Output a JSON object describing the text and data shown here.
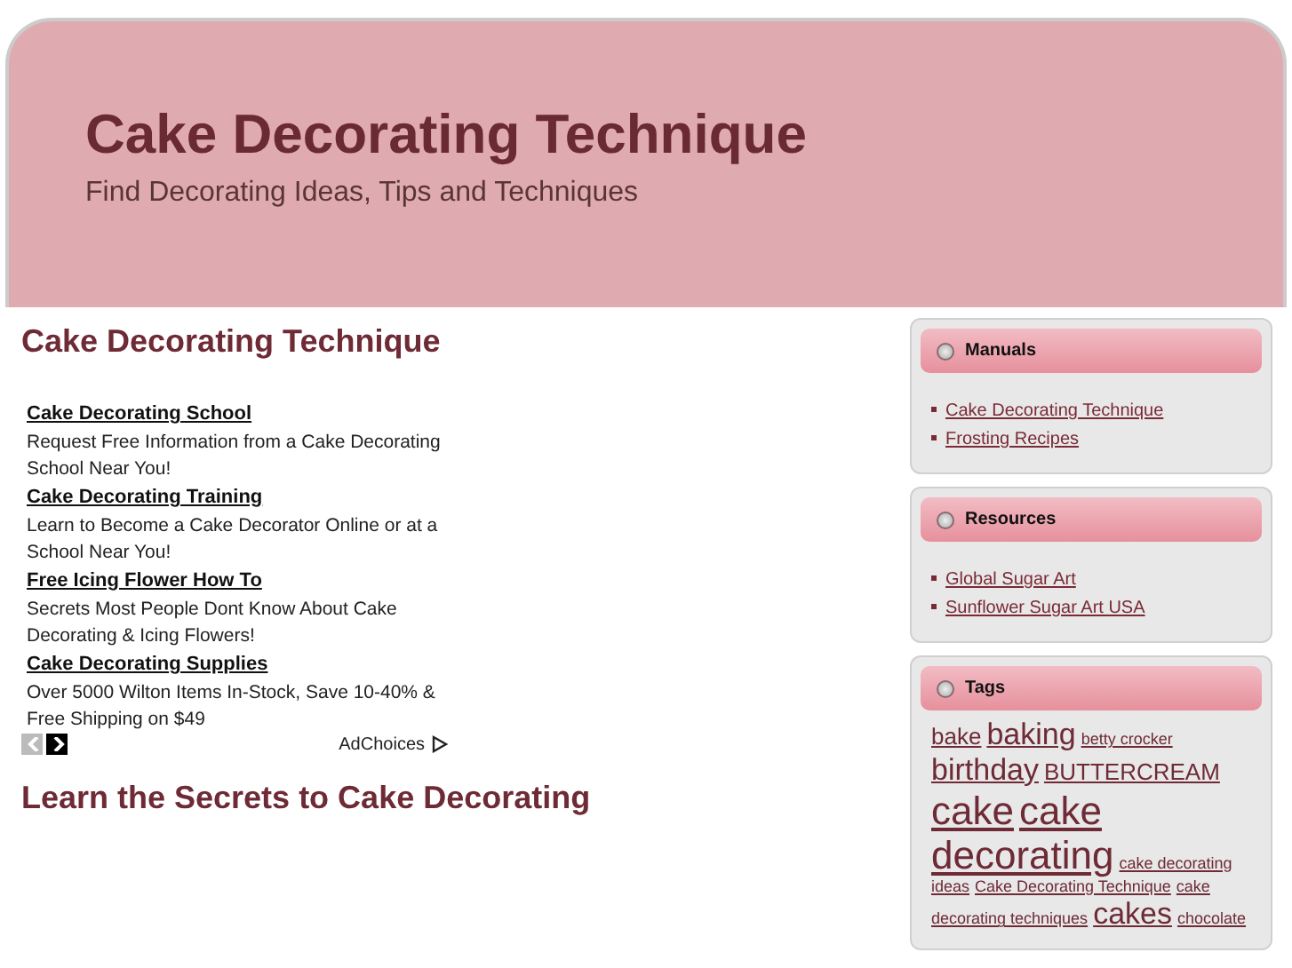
{
  "header": {
    "title": "Cake Decorating Technique",
    "tagline": "Find Decorating Ideas, Tips and Techniques"
  },
  "main": {
    "title": "Cake Decorating Technique",
    "ads": [
      {
        "title": "Cake Decorating School",
        "text": "Request Free Information from a Cake Decorating School Near You!"
      },
      {
        "title": "Cake Decorating Training",
        "text": "Learn to Become a Cake Decorator Online or at a School Near You!"
      },
      {
        "title": "Free Icing Flower How To",
        "text": "Secrets Most People Dont Know About Cake Decorating & Icing Flowers!"
      },
      {
        "title": "Cake Decorating Supplies",
        "text": "Over 5000 Wilton Items In-Stock, Save 10-40% & Free Shipping on $49"
      }
    ],
    "ad_nav": {
      "prev_disabled": true,
      "next_disabled": false
    },
    "ad_choices": "AdChoices",
    "heading": "Learn the Secrets to Cake Decorating"
  },
  "sidebar": [
    {
      "kind": "links",
      "title": "Manuals",
      "items": [
        "Cake Decorating Technique",
        "Frosting Recipes"
      ]
    },
    {
      "kind": "links",
      "title": "Resources",
      "items": [
        "Global Sugar Art",
        "Sunflower Sugar Art USA"
      ]
    },
    {
      "kind": "tags",
      "title": "Tags",
      "items": [
        {
          "label": "bake",
          "kind": "medium"
        },
        {
          "label": "baking",
          "kind": "large"
        },
        {
          "label": "betty crocker",
          "kind": "small"
        },
        {
          "label": "birthday",
          "kind": "large"
        },
        {
          "label": "BUTTERCREAM",
          "kind": "medium"
        },
        {
          "label": "cake",
          "kind": "xlarge"
        },
        {
          "label": "cake",
          "kind": "xlarge"
        },
        {
          "label": "decorating",
          "kind": "xlarge"
        },
        {
          "label": "cake decorating",
          "kind": "small"
        },
        {
          "label": "ideas",
          "kind": "small"
        },
        {
          "label": "Cake Decorating Technique",
          "kind": "small"
        },
        {
          "label": "cake",
          "kind": "small"
        },
        {
          "label": "decorating techniques",
          "kind": "small"
        },
        {
          "label": "cakes",
          "kind": "large"
        },
        {
          "label": "chocolate",
          "kind": "small"
        }
      ]
    }
  ]
}
